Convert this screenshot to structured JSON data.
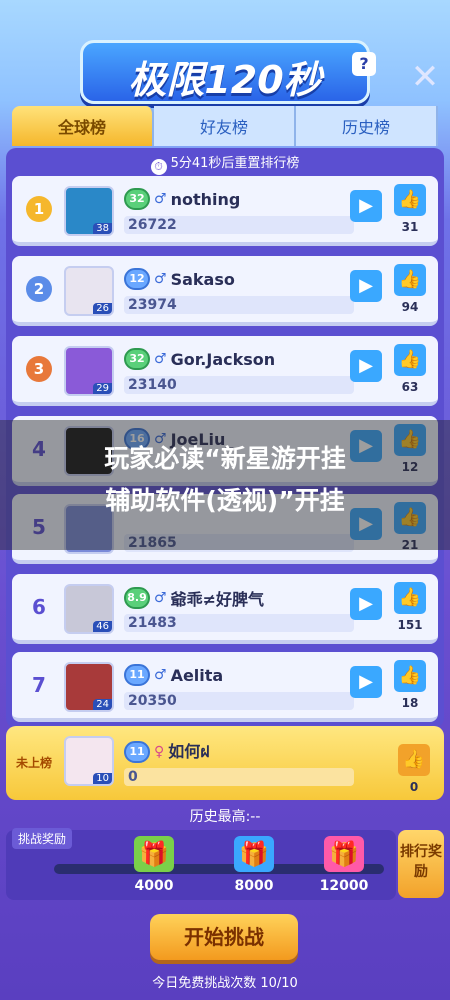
{
  "header": {
    "title": "极限120秒",
    "help_label": "?",
    "close_label": "✕"
  },
  "tabs": [
    {
      "label": "全球榜",
      "active": true
    },
    {
      "label": "好友榜",
      "active": false
    },
    {
      "label": "历史榜",
      "active": false
    }
  ],
  "reset_text": "5分41秒后重置排行榜",
  "rows": [
    {
      "rank": "1",
      "level": "38",
      "badge": "32",
      "sex": "♂",
      "name": "nothing",
      "score": "26722",
      "likes": "31"
    },
    {
      "rank": "2",
      "level": "26",
      "badge": "12",
      "sex": "♂",
      "name": "Sakaso",
      "score": "23974",
      "likes": "94"
    },
    {
      "rank": "3",
      "level": "29",
      "badge": "32",
      "sex": "♂",
      "name": "Gor.Jackson",
      "score": "23140",
      "likes": "63"
    },
    {
      "rank": "4",
      "level": "",
      "badge": "16",
      "sex": "♂",
      "name": "JoeLiu_",
      "score": "",
      "likes": "12"
    },
    {
      "rank": "5",
      "level": "",
      "badge": "",
      "sex": "",
      "name": "",
      "score": "21865",
      "likes": "21"
    },
    {
      "rank": "6",
      "level": "46",
      "badge": "8.9",
      "sex": "♂",
      "name": "爺乖≠好脾气",
      "score": "21483",
      "likes": "151"
    },
    {
      "rank": "7",
      "level": "24",
      "badge": "11",
      "sex": "♂",
      "name": "Aelita",
      "score": "20350",
      "likes": "18"
    }
  ],
  "my_row": {
    "rank_label": "未上榜",
    "level": "10",
    "badge": "11",
    "sex": "♀",
    "name": "如何ฝ",
    "score": "0",
    "likes": "0"
  },
  "banner": {
    "line1": "玩家必读“新星游开挂",
    "line2": "辅助软件(透视)”开挂"
  },
  "history_best": "历史最高:--",
  "reward": {
    "title": "挑战奖励",
    "values": [
      "4000",
      "8000",
      "12000"
    ],
    "rank_reward_label": "排行奖励"
  },
  "start_button": "开始挑战",
  "daily_text": "今日免费挑战次数 10/10",
  "colors": {
    "accent": "#3aa8ff",
    "gold": "#f7c83a",
    "panel": "#5b4fd1"
  }
}
